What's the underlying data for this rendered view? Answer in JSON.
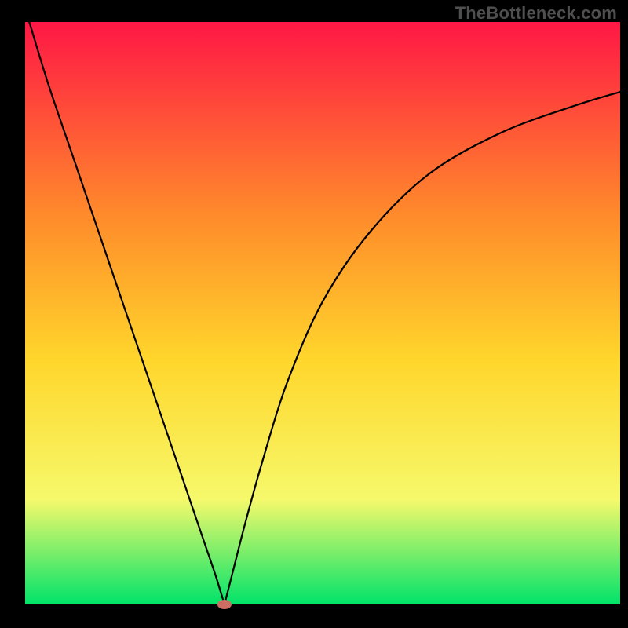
{
  "watermark": "TheBottleneck.com",
  "chart_data": {
    "type": "line",
    "title": "",
    "xlabel": "",
    "ylabel": "",
    "xlim": [
      0,
      100
    ],
    "ylim": [
      0,
      100
    ],
    "grid": false,
    "background_gradient": {
      "top": "#ff1745",
      "upper_mid": "#ff8a2b",
      "mid": "#ffd62b",
      "lower_mid": "#f6f96b",
      "bottom": "#00e36a"
    },
    "series": [
      {
        "name": "left-branch",
        "x": [
          0.7,
          4,
          8,
          12,
          16,
          20,
          24,
          28,
          30,
          32,
          33.5
        ],
        "y": [
          100,
          89,
          77,
          65,
          53,
          41,
          29,
          17,
          11,
          5,
          0
        ]
      },
      {
        "name": "right-branch",
        "x": [
          33.5,
          35,
          37,
          40,
          44,
          50,
          58,
          68,
          80,
          92,
          100
        ],
        "y": [
          0,
          6,
          14,
          25,
          38,
          52,
          64,
          74,
          81,
          85.5,
          88
        ]
      }
    ],
    "marker": {
      "name": "minimum-point",
      "x": 33.5,
      "y": 0,
      "color": "#cc6e63"
    }
  }
}
